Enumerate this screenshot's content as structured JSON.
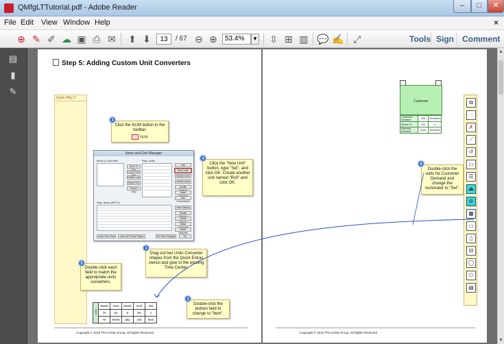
{
  "window": {
    "title": "QMfgLTTutorial.pdf - Adobe Reader",
    "minimize": "–",
    "maximize": "□",
    "close": "✕"
  },
  "menu": {
    "items": [
      "File",
      "Edit",
      "View",
      "Window",
      "Help"
    ],
    "close_label": "×"
  },
  "toolbar": {
    "current_page": "13",
    "total_pages": "/ 67",
    "zoom": "53.4%",
    "links": [
      "Tools",
      "Sign",
      "Comment"
    ],
    "icons": [
      "create-pdf-icon",
      "acrobat-icon",
      "edit-icon",
      "cloud-upload-icon",
      "save-icon",
      "print-icon",
      "email-icon",
      "prev-page-icon",
      "next-page-icon",
      "zoom-out-icon",
      "zoom-in-icon",
      "fit-page-icon",
      "fit-width-icon",
      "two-page-icon",
      "comment-icon",
      "highlight-icon",
      "fullscreen-icon"
    ]
  },
  "left_page": {
    "heading": "Step 5:  Adding Custom Unit Converters",
    "side_column_label": "Quick Mfg LT",
    "callouts": {
      "c3": {
        "badge": "3",
        "text": "Click the NUM button in the toolbar.",
        "button_label": "NUM"
      },
      "c4": {
        "badge": "4",
        "text": "Click the \"New Unit\" button, type \"Set\", and click OK. Create another unit named \"Roll\" and click OK."
      },
      "c1": {
        "badge": "1",
        "text": "Drag out two Units Converter shapes from the Quick Extras stencil and glue to the existing Time Center."
      },
      "c5": {
        "badge": "5",
        "text": "Double-click each field to match the appropriate units converters."
      },
      "c2": {
        "badge": "2",
        "text": "Double-click the bottom field to change to \"Item\"."
      }
    },
    "dialog": {
      "title": "Items and Unit Manager",
      "left_header": "Items & Unit Sets",
      "right_header": "Reg. Units",
      "list_header": "Reg. Items (SET's)",
      "buttons": [
        "Save To File",
        "Load From File",
        "Delete Unit",
        "Select Non",
        "Pinned Only"
      ],
      "right_buttons": [
        "Add",
        "New Units",
        "Modify Units",
        "Delete Units",
        "Modify Dataset",
        "Make Obsolete",
        "Add Conversions"
      ],
      "list_buttons": [
        "New Display",
        "Modify Display",
        "Delete Display",
        "Make Calibrate",
        "Make Obsolete",
        "Add Display"
      ],
      "bottom_buttons": [
        "Load From Row",
        "Clear all Preset Pages",
        "Set this Changes",
        "OK"
      ]
    },
    "units_table": {
      "side_label": "Units",
      "rows": [
        [
          "Week",
          "Year",
          "Week",
          "Roll",
          "Set"
        ],
        [
          "70",
          "52",
          "5",
          "50",
          "1"
        ],
        [
          "Hr",
          "Week",
          "day",
          "Set",
          "Item"
        ]
      ]
    },
    "copyright": "Copyright © 2015 The eVSM Group, All Rights Reserved"
  },
  "right_page": {
    "customer_label": "Customer",
    "customer_rows": [
      [
        "Customer Demand",
        "900",
        "Set/Week"
      ],
      [
        "Where %",
        "100",
        "%"
      ],
      [
        "Effective Demand",
        "Auto",
        "Set/Week"
      ]
    ],
    "callout6": {
      "badge": "6",
      "text": "Double-click the units for Customer Demand and change the numerator to \"Set\"."
    },
    "copyright": "Copyright © 2015 The eVSM Group, All Rights Reserved"
  }
}
